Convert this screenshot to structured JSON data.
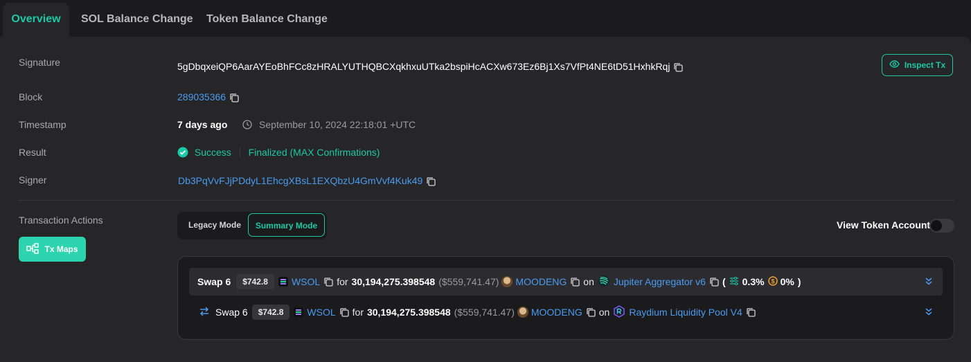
{
  "tabs": [
    {
      "label": "Overview",
      "active": true
    },
    {
      "label": "SOL Balance Change",
      "active": false
    },
    {
      "label": "Token Balance Change",
      "active": false
    }
  ],
  "fields": {
    "signature_label": "Signature",
    "signature": "5gDbqxeiQP6AarAYEoBhFCc8zHRALYUTHQBCXqkhxuUTka2bspiHcACXw673Ez6Bj1Xs7VfPt4NE6tD51HxhkRqj",
    "block_label": "Block",
    "block": "289035366",
    "timestamp_label": "Timestamp",
    "timestamp_relative": "7 days ago",
    "timestamp_full": "September 10, 2024 22:18:01 +UTC",
    "result_label": "Result",
    "result_status": "Success",
    "result_confirmation": "Finalized (MAX Confirmations)",
    "signer_label": "Signer",
    "signer": "Db3PqVvFJjPDdyL1EhcgXBsL1EXQbzU4GmVvf4Kuk49"
  },
  "inspect_label": "Inspect Tx",
  "actions": {
    "label": "Transaction Actions",
    "txmaps_label": "Tx Maps",
    "legacy_mode": "Legacy Mode",
    "summary_mode": "Summary Mode",
    "view_token_account": "View Token Account",
    "view_token_account_on": false
  },
  "swaps": [
    {
      "title": "Swap 6",
      "usd": "$742.8",
      "from_token": "WSOL",
      "for_word": "for",
      "amount": "30,194,275.398548",
      "amount_usd": "($559,741.47)",
      "to_token": "MOODENG",
      "on_word": "on",
      "platform": "Jupiter Aggregator v6",
      "paren_open": "(",
      "slippage": "0.3%",
      "fee": "0%",
      "paren_close": ")"
    },
    {
      "title": "Swap 6",
      "usd": "$742.8",
      "from_token": "WSOL",
      "for_word": "for",
      "amount": "30,194,275.398548",
      "amount_usd": "($559,741.47)",
      "to_token": "MOODENG",
      "on_word": "on",
      "platform": "Raydium Liquidity Pool V4"
    }
  ],
  "colors": {
    "accent": "#1cc9a6",
    "link": "#4a9bf0",
    "panel": "#262629",
    "background": "#1b1b1d",
    "fee": "#f0a030"
  }
}
